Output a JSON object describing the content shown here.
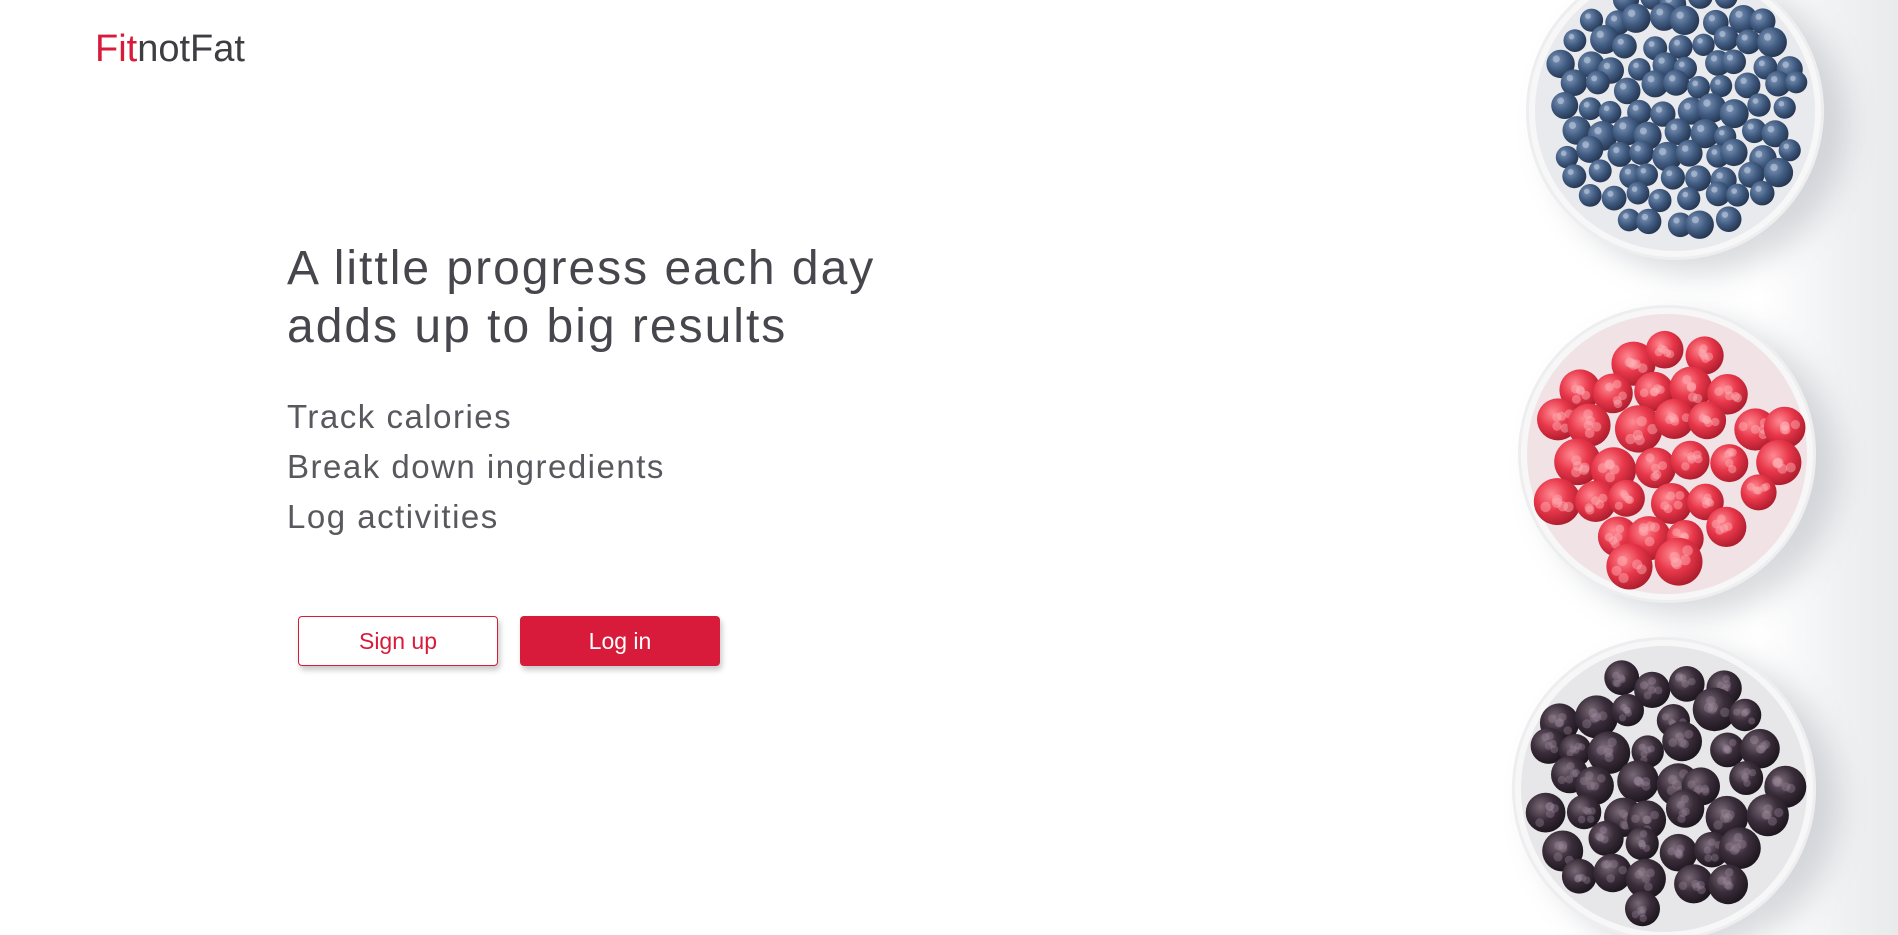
{
  "brand": {
    "logo_fit": "Fit",
    "logo_rest": "notFat",
    "accent_color": "#d81b3a",
    "text_color": "#46464c"
  },
  "hero": {
    "headline_line1": "A little progress each day",
    "headline_line2": "adds up to big results",
    "features": [
      "Track calories",
      "Break down ingredients",
      "Log activities"
    ]
  },
  "actions": {
    "signup_label": "Sign up",
    "login_label": "Log in"
  },
  "images": [
    {
      "name": "blueberries-bowl-image",
      "color": "#3f5a80"
    },
    {
      "name": "raspberries-bowl-image",
      "color": "#e8374a"
    },
    {
      "name": "blackberries-bowl-image",
      "color": "#2e2430"
    }
  ]
}
